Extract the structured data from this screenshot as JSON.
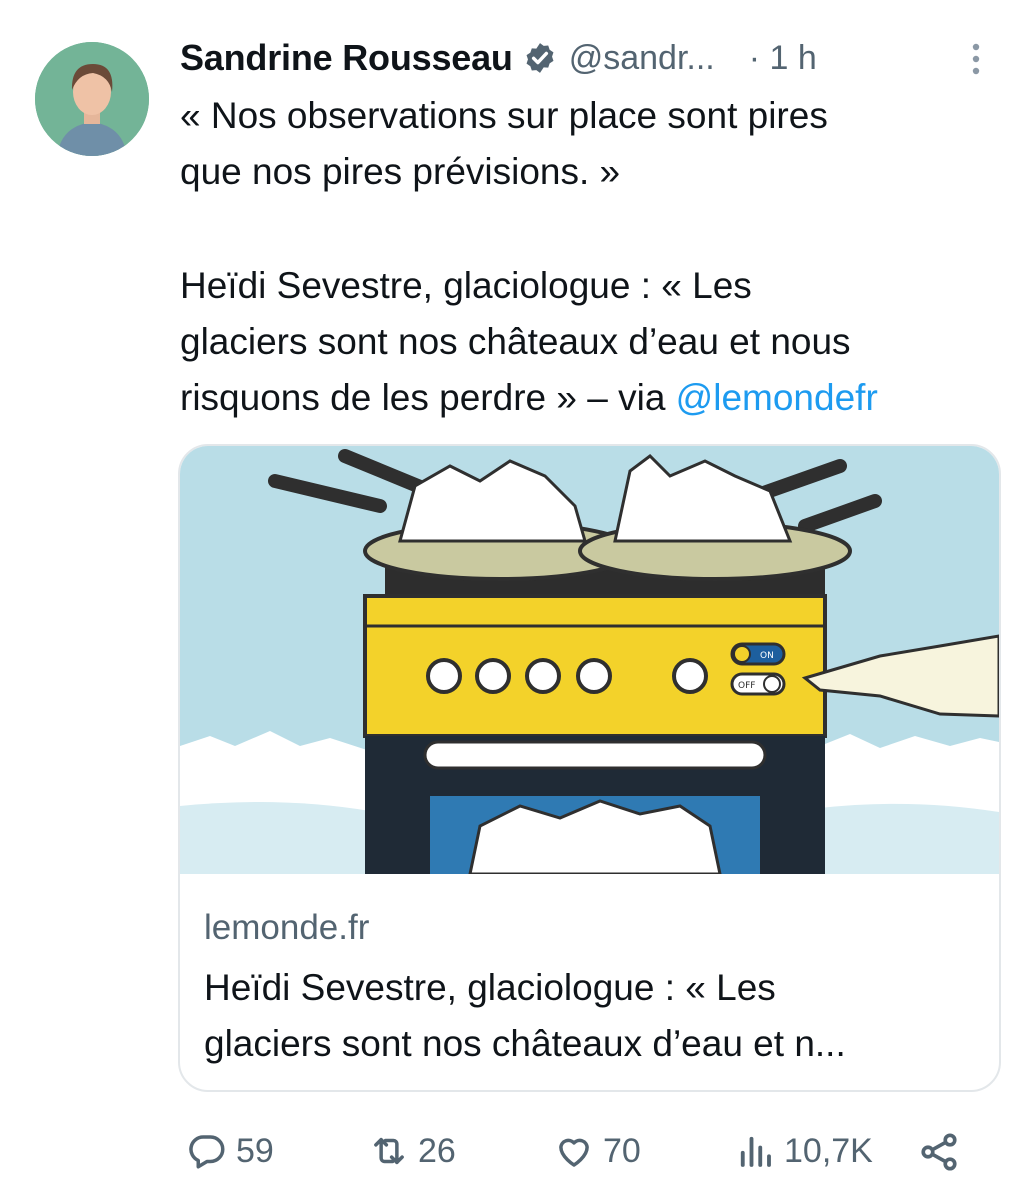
{
  "tweet": {
    "author_name": "Sandrine Rousseau",
    "handle": "@sandr...",
    "time": "· 1 h",
    "line1": "« Nos observations sur place sont pires",
    "line2": "que nos pires prévisions. »",
    "line3": "Heïdi Sevestre, glaciologue : « Les",
    "line4": "glaciers sont nos châteaux d’eau et nous",
    "line5_prefix": "risquons de les perdre » – via ",
    "mention": "@lemondefr"
  },
  "card": {
    "domain": "lemonde.fr",
    "title_line1": "Heïdi Sevestre, glaciologue : « Les",
    "title_line2": "glaciers sont nos châteaux d’eau et n...",
    "image_subject": "stove-melting-glaciers-illustration",
    "switch_on": "ON",
    "switch_off": "OFF"
  },
  "actions": {
    "replies": "59",
    "reposts": "26",
    "likes": "70",
    "views": "10,7K"
  },
  "colors": {
    "accent": "#1d9bf0",
    "secondary_text": "#536471",
    "stove_yellow": "#f3d22a",
    "sky": "#b9dde7"
  }
}
